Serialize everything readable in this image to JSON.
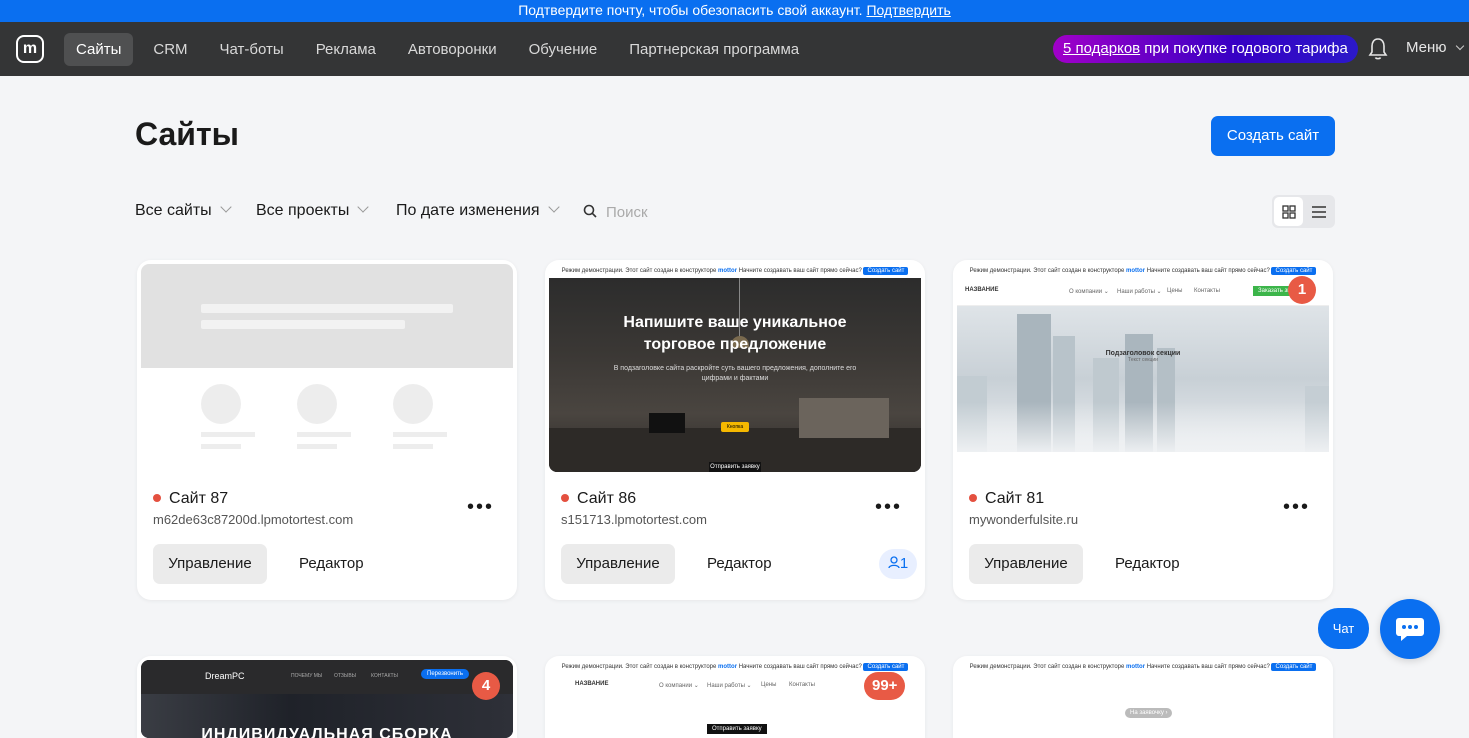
{
  "banner": {
    "text": "Подтвердите почту, чтобы обезопасить свой аккаунт.",
    "link": "Подтвердить"
  },
  "nav": {
    "logo": "m",
    "items": [
      "Сайты",
      "CRM",
      "Чат-боты",
      "Реклама",
      "Автоворонки",
      "Обучение",
      "Партнерская программа"
    ],
    "promo_link": "5 подарков",
    "promo_text": "при покупке годового тарифа",
    "menu": "Меню"
  },
  "page": {
    "title": "Сайты",
    "create_button": "Создать сайт"
  },
  "filters": {
    "sites": "Все сайты",
    "projects": "Все проекты",
    "sort": "По дате изменения",
    "search_placeholder": "Поиск"
  },
  "cards": [
    {
      "name": "Сайт 87",
      "domain": "m62de63c87200d.lpmotortest.com",
      "manage": "Управление",
      "editor": "Редактор"
    },
    {
      "name": "Сайт 86",
      "domain": "s151713.lpmotortest.com",
      "manage": "Управление",
      "editor": "Редактор",
      "collaborators": "1",
      "demo_bar": "Режим демонстрации. Этот сайт создан в конструкторе",
      "demo_bar_brand": "mottor",
      "demo_bar_tail": "Начните создавать ваш сайт прямо сейчас?",
      "demo_button": "Создать сайт",
      "hero_title_1": "Напишите ваше уникальное",
      "hero_title_2": "торговое предложение",
      "hero_sub_1": "В подзаголовке сайта раскройте суть вашего предложения, дополните его",
      "hero_sub_2": "цифрами и фактами",
      "hero_button": "Кнопка",
      "hero_bottom": "Отправить заявку"
    },
    {
      "name": "Сайт 81",
      "domain": "mywonderfulsite.ru",
      "manage": "Управление",
      "editor": "Редактор",
      "badge": "1",
      "site_name": "НАЗВАНИЕ",
      "menu": [
        "О компании ⌄",
        "Наши работы ⌄",
        "Цены",
        "Контакты"
      ],
      "cta": "Заказать звонок",
      "section_title": "Подзаголовок секции",
      "section_sub": "Текст секции"
    }
  ],
  "cards_row2": [
    {
      "badge": "4",
      "brand": "DreamPC",
      "menu": [
        "ПОЧЕМУ МЫ",
        "ОТЗЫВЫ",
        "КОНТАКТЫ"
      ],
      "cta": "Перезвонить",
      "hero": "ИНДИВИДУАЛЬНАЯ СБОРКА"
    },
    {
      "badge": "99+",
      "site_name": "НАЗВАНИЕ",
      "menu": [
        "О компании ⌄",
        "Наши работы ⌄",
        "Цены",
        "Контакты"
      ],
      "button": "Отправить заявку"
    },
    {
      "chip": "На заявочку ›"
    }
  ],
  "chat": {
    "label": "Чат"
  }
}
